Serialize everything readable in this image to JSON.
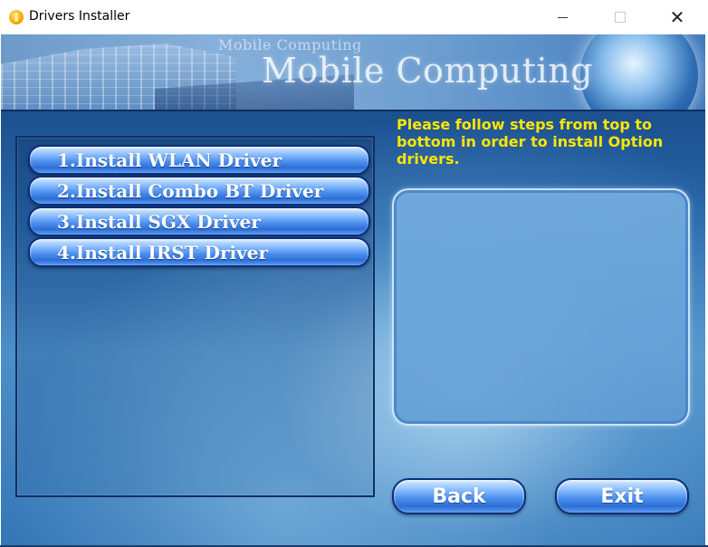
{
  "window": {
    "title": "Drivers Installer",
    "minimize_glyph": "",
    "maximize_glyph": "",
    "close_glyph": "✕"
  },
  "banner": {
    "small_text": "Mobile Computing",
    "big_text": "Mobile Computing"
  },
  "drivers": [
    {
      "label": "1.Install WLAN Driver"
    },
    {
      "label": "2.Install Combo BT Driver"
    },
    {
      "label": "3.Install SGX Driver"
    },
    {
      "label": "4.Install IRST Driver"
    }
  ],
  "instruction_text": "Please follow steps from top to bottom in order to install Option drivers.",
  "info_text": "",
  "nav": {
    "back_label": "Back",
    "exit_label": "Exit"
  },
  "colors": {
    "instruction": "#ffe600",
    "button_border": "#0b2f7a",
    "background_dark": "#123e7a"
  },
  "icons": {
    "app": "installer-app-icon",
    "minimize": "minimize-icon",
    "maximize": "maximize-icon",
    "close": "close-icon"
  }
}
